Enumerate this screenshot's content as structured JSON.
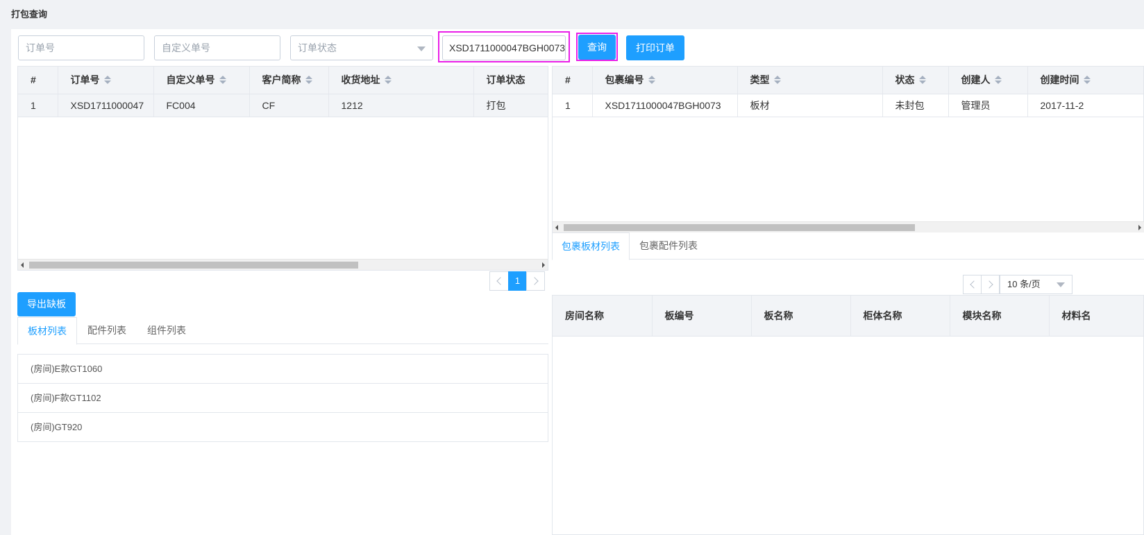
{
  "page": {
    "title": "打包查询"
  },
  "search": {
    "order_no_placeholder": "订单号",
    "custom_no_placeholder": "自定义单号",
    "status_placeholder": "订单状态",
    "package_no_value": "XSD1711000047BGH0073",
    "query_label": "查询",
    "print_label": "打印订单"
  },
  "orders": {
    "headers": [
      "#",
      "订单号",
      "自定义单号",
      "客户简称",
      "收货地址",
      "订单状态"
    ],
    "rows": [
      [
        "1",
        "XSD1711000047",
        "FC004",
        "CF",
        "1212",
        "打包"
      ]
    ],
    "pager": {
      "current": "1"
    }
  },
  "packages": {
    "headers": [
      "#",
      "包裹编号",
      "类型",
      "状态",
      "创建人",
      "创建时间"
    ],
    "rows": [
      [
        "1",
        "XSD1711000047BGH0073",
        "板材",
        "未封包",
        "管理员",
        "2017-11-2"
      ]
    ]
  },
  "left_bottom": {
    "export_label": "导出缺板",
    "tabs": [
      "板材列表",
      "配件列表",
      "组件列表"
    ],
    "items": [
      "(房间)E款GT1060",
      "(房间)F款GT1102",
      "(房间)GT920"
    ]
  },
  "right_bottom": {
    "tabs": [
      "包裹板材列表",
      "包裹配件列表"
    ],
    "page_size": "10 条/页",
    "headers": [
      "房间名称",
      "板编号",
      "板名称",
      "柜体名称",
      "模块名称",
      "材料名"
    ]
  },
  "colors": {
    "accent": "#1e9fff",
    "highlight": "#e91ee8"
  }
}
